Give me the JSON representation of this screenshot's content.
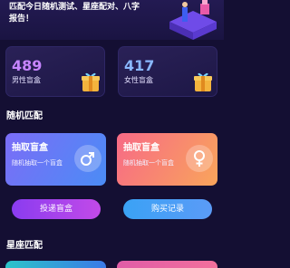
{
  "hero": {
    "text": "匹配今日随机测试、星座配对、八字报告！"
  },
  "stats": [
    {
      "count": "489",
      "label": "男性盲盒",
      "color": "#c785ff"
    },
    {
      "count": "417",
      "label": "女性盲盒",
      "color": "#8ab8ff"
    }
  ],
  "random_section": {
    "title": "随机匹配",
    "cards": [
      {
        "title": "抽取盲盒",
        "subtitle": "随机抽取一个盲盒",
        "icon": "male-symbol-icon"
      },
      {
        "title": "抽取盲盒",
        "subtitle": "随机抽取一个盲盒",
        "icon": "female-symbol-icon"
      }
    ],
    "buttons": {
      "send": "投递盲盒",
      "record": "购买记录"
    }
  },
  "zodiac_section": {
    "title": "星座匹配"
  }
}
